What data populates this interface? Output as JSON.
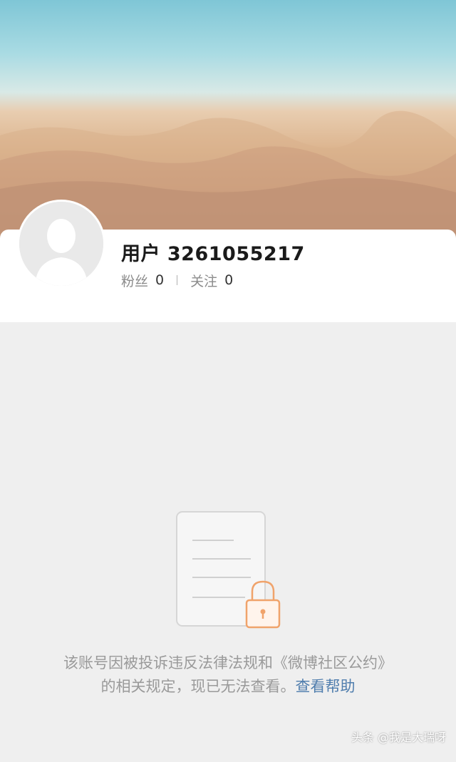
{
  "profile": {
    "username": "用户 3261055217",
    "followers_label": "粉丝",
    "followers_count": "0",
    "following_label": "关注",
    "following_count": "0"
  },
  "notice": {
    "message": "该账号因被投诉违反法律法规和《微博社区公约》的相关规定，现已无法查看。",
    "help_link": "查看帮助"
  },
  "watermark": "头条 @我是大瑞呀",
  "icons": {
    "avatar": "default-avatar-icon",
    "locked_document": "locked-document-icon"
  },
  "colors": {
    "background": "#efefef",
    "link": "#4f7dad",
    "lock_accent": "#f0a36b"
  }
}
